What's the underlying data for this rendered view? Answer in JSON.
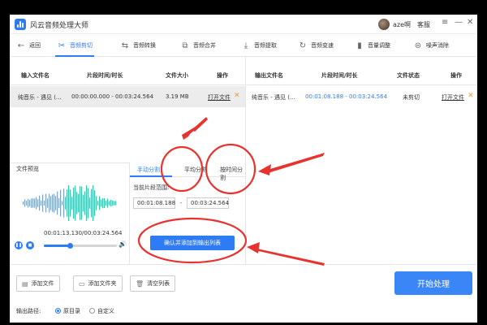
{
  "app": {
    "title": "风云音频处理大师",
    "username": "aze啊",
    "customer_service": "客服"
  },
  "window_controls": {
    "menu": "≡",
    "minimize": "—",
    "close": "✕"
  },
  "toolbar": {
    "back": "返回",
    "tools": [
      {
        "label": "音频剪切",
        "icon": "✂"
      },
      {
        "label": "音频转换",
        "icon": "⇆"
      },
      {
        "label": "音频合并",
        "icon": "⧉"
      },
      {
        "label": "音频提取",
        "icon": "⤓"
      },
      {
        "label": "音频变速",
        "icon": "↻"
      },
      {
        "label": "音量调整",
        "icon": "▮"
      },
      {
        "label": "噪声消除",
        "icon": "⊜"
      }
    ]
  },
  "input_table": {
    "headers": [
      "输入文件名",
      "片段时间/时长",
      "文件大小",
      "操作"
    ],
    "rows": [
      {
        "name": "纯音乐 - 遇见 (...",
        "time": "00:00:00.000 - 00:03:24.564",
        "size": "3.19 MB",
        "action": "打开文件",
        "remove": "✕"
      }
    ]
  },
  "output_table": {
    "headers": [
      "输出文件名",
      "片段时间/时长",
      "文件状态",
      "操作"
    ],
    "rows": [
      {
        "name": "纯音乐 - 遇见 (...",
        "time": "00:01:08.188 - 00:03:24.564",
        "status": "未剪切",
        "action": "打开文件",
        "remove": "✕"
      }
    ]
  },
  "preview": {
    "title": "文件预览",
    "timecode": "00:01:13.130/00:03:24.564",
    "progress": 0.36,
    "play_icon": "❚❚",
    "stop_icon": "■",
    "volume_icon": "🔊"
  },
  "split": {
    "tabs": [
      "手动分割",
      "平均分割",
      "按时间分割"
    ],
    "range_label": "当前片段范围:",
    "start": "00:01:08.188",
    "end": "00:03:24.564",
    "dash": "-",
    "confirm": "确认并添加到输出列表"
  },
  "bottom": {
    "add_file": "添加文件",
    "add_folder": "添加文件夹",
    "clear_list": "清空列表",
    "output_path_label": "输出路径:",
    "option_original": "原目录",
    "option_custom": "自定义",
    "start": "开始处理"
  },
  "colors": {
    "accent": "#2d7cf6",
    "annotation": "#e8322f",
    "remove": "#f39c3d"
  }
}
